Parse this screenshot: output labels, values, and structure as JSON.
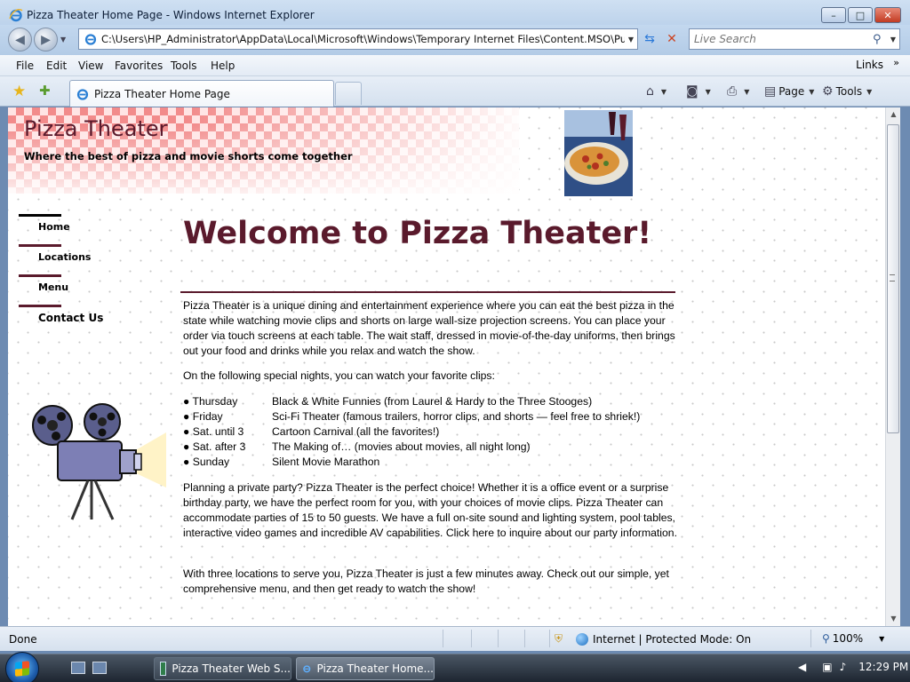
{
  "window": {
    "title": "Pizza Theater Home Page - Windows Internet Explorer",
    "controls": [
      "–",
      "□",
      "✕"
    ]
  },
  "address_bar": {
    "url": "C:\\Users\\HP_Administrator\\AppData\\Local\\Microsoft\\Windows\\Temporary Internet Files\\Content.MSO\\PubW",
    "search_placeholder": "Live Search"
  },
  "menu": {
    "items": [
      "File",
      "Edit",
      "View",
      "Favorites",
      "Tools",
      "Help"
    ],
    "links_label": "Links"
  },
  "tabs": {
    "active_tab": "Pizza Theater Home Page"
  },
  "commands": {
    "page_label": "Page",
    "tools_label": "Tools"
  },
  "page": {
    "site_title": "Pizza Theater",
    "tagline": "Where the best of pizza and movie shorts come together",
    "nav": [
      "Home",
      "Locations",
      "Menu",
      "Contact Us"
    ],
    "heading": "Welcome to Pizza Theater!",
    "intro": "Pizza Theater is a unique dining and entertainment experience where you can eat the best pizza in the state while watching movie clips and shorts on large wall-size projection screens. You can place your order via touch screens at each table.  The wait staff, dressed in movie-of-the-day uniforms, then brings out your food and drinks while you relax and watch the show.",
    "special_intro": "On the following special nights, you can watch your favorite clips:",
    "special_nights": [
      {
        "day": "● Thursday",
        "show": "Black & White Funnies (from Laurel & Hardy to the Three Stooges)"
      },
      {
        "day": "● Friday",
        "show": "Sci-Fi Theater (famous trailers, horror clips, and shorts — feel free to shriek!)"
      },
      {
        "day": "● Sat. until 3",
        "show": " Cartoon Carnival (all the favorites!)"
      },
      {
        "day": "● Sat. after 3",
        "show": "The Making of… (movies about movies, all night long)"
      },
      {
        "day": "● Sunday",
        "show": "Silent Movie Marathon"
      }
    ],
    "party": "Planning a private party? Pizza Theater is the perfect choice! Whether it is a office event or a surprise birthday party, we have the perfect room for you, with your choices of movie clips. Pizza Theater can accommodate parties of 15 to 50 guests. We have a full on-site sound and lighting system, pool tables, interactive video games and incredible AV capabilities. Click here to inquire about our party information.",
    "locations": "With three locations to serve you, Pizza Theater is just a few minutes away. Check out our simple, yet comprehensive menu, and then get ready to watch the show!"
  },
  "status": {
    "text": "Done",
    "zone": "Internet | Protected Mode: On",
    "zoom": "100%"
  },
  "taskbar": {
    "buttons": [
      "Pizza Theater Web S...",
      "Pizza Theater Home..."
    ],
    "clock": "12:29 PM"
  },
  "colors": {
    "accent": "#5a1a2c",
    "banner_check": "#f28b8b"
  }
}
